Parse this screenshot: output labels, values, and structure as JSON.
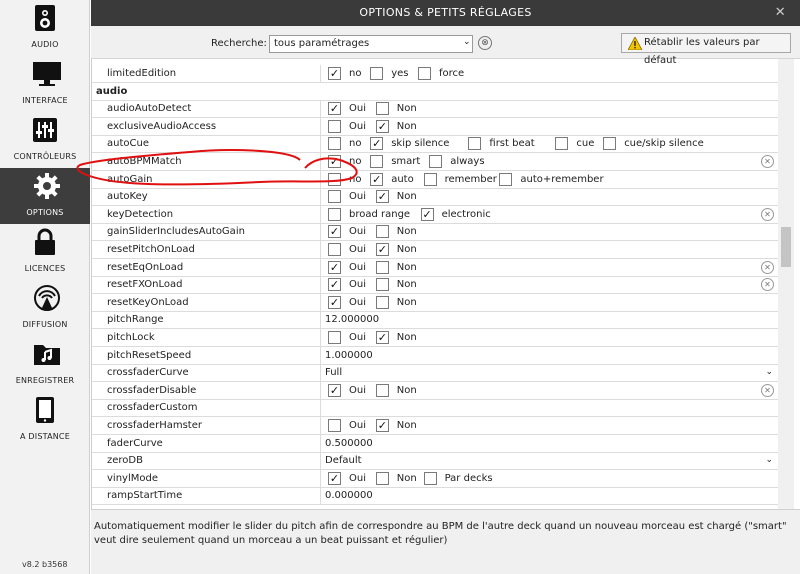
{
  "window": {
    "title": "OPTIONS & PETITS RÉGLAGES",
    "close": "✕"
  },
  "sidebar": {
    "items": [
      {
        "label": "AUDIO",
        "icon": "speaker-icon"
      },
      {
        "label": "INTERFACE",
        "icon": "monitor-icon"
      },
      {
        "label": "CONTRÔLEURS",
        "icon": "sliders-icon"
      },
      {
        "label": "OPTIONS",
        "icon": "gear-icon",
        "active": true
      },
      {
        "label": "LICENCES",
        "icon": "lock-icon"
      },
      {
        "label": "DIFFUSION",
        "icon": "broadcast-icon"
      },
      {
        "label": "ENREGISTRER",
        "icon": "music-folder-icon"
      },
      {
        "label": "A DISTANCE",
        "icon": "tablet-icon"
      }
    ],
    "version": "v8.2 b3568"
  },
  "search": {
    "label": "Recherche:",
    "value": "tous paramétrages",
    "caret": "⌄",
    "clear": "⊗",
    "reset_label": "Rétablir les valeurs par défaut"
  },
  "rows": [
    {
      "key": "limitedEdition",
      "options": [
        {
          "label": "no",
          "checked": true
        },
        {
          "label": "yes",
          "checked": false
        },
        {
          "label": "force",
          "checked": false
        }
      ]
    },
    {
      "key": "audio",
      "section": true
    },
    {
      "key": "audioAutoDetect",
      "options": [
        {
          "label": "Oui",
          "checked": true
        },
        {
          "label": "Non",
          "checked": false
        }
      ]
    },
    {
      "key": "exclusiveAudioAccess",
      "options": [
        {
          "label": "Oui",
          "checked": false
        },
        {
          "label": "Non",
          "checked": true
        }
      ]
    },
    {
      "key": "autoCue",
      "options": [
        {
          "label": "no",
          "checked": false
        },
        {
          "label": "skip silence",
          "checked": true
        },
        {
          "label": "first beat",
          "checked": false
        },
        {
          "label": "cue",
          "checked": false
        },
        {
          "label": "cue/skip silence",
          "checked": false
        }
      ]
    },
    {
      "key": "autoBPMMatch",
      "options": [
        {
          "label": "no",
          "checked": true
        },
        {
          "label": "smart",
          "checked": false
        },
        {
          "label": "always",
          "checked": false
        }
      ],
      "clear": true
    },
    {
      "key": "autoGain",
      "options": [
        {
          "label": "no",
          "checked": false
        },
        {
          "label": "auto",
          "checked": true
        },
        {
          "label": "remember",
          "checked": false
        },
        {
          "label": "auto+remember",
          "checked": false
        }
      ]
    },
    {
      "key": "autoKey",
      "options": [
        {
          "label": "Oui",
          "checked": false
        },
        {
          "label": "Non",
          "checked": true
        }
      ]
    },
    {
      "key": "keyDetection",
      "options": [
        {
          "label": "broad range",
          "checked": false
        },
        {
          "label": "electronic",
          "checked": true
        }
      ],
      "clear": true
    },
    {
      "key": "gainSliderIncludesAutoGain",
      "options": [
        {
          "label": "Oui",
          "checked": true
        },
        {
          "label": "Non",
          "checked": false
        }
      ]
    },
    {
      "key": "resetPitchOnLoad",
      "options": [
        {
          "label": "Oui",
          "checked": false
        },
        {
          "label": "Non",
          "checked": true
        }
      ]
    },
    {
      "key": "resetEqOnLoad",
      "options": [
        {
          "label": "Oui",
          "checked": true
        },
        {
          "label": "Non",
          "checked": false
        }
      ],
      "clear": true
    },
    {
      "key": "resetFXOnLoad",
      "options": [
        {
          "label": "Oui",
          "checked": true
        },
        {
          "label": "Non",
          "checked": false
        }
      ],
      "clear": true
    },
    {
      "key": "resetKeyOnLoad",
      "options": [
        {
          "label": "Oui",
          "checked": true
        },
        {
          "label": "Non",
          "checked": false
        }
      ]
    },
    {
      "key": "pitchRange",
      "text": "12.000000"
    },
    {
      "key": "pitchLock",
      "options": [
        {
          "label": "Oui",
          "checked": false
        },
        {
          "label": "Non",
          "checked": true
        }
      ]
    },
    {
      "key": "pitchResetSpeed",
      "text": "1.000000"
    },
    {
      "key": "crossfaderCurve",
      "text": "Full",
      "dropdown": true
    },
    {
      "key": "crossfaderDisable",
      "options": [
        {
          "label": "Oui",
          "checked": true
        },
        {
          "label": "Non",
          "checked": false
        }
      ],
      "clear": true
    },
    {
      "key": "crossfaderCustom",
      "text": ""
    },
    {
      "key": "crossfaderHamster",
      "options": [
        {
          "label": "Oui",
          "checked": false
        },
        {
          "label": "Non",
          "checked": true
        }
      ]
    },
    {
      "key": "faderCurve",
      "text": "0.500000"
    },
    {
      "key": "zeroDB",
      "text": "Default",
      "dropdown": true
    },
    {
      "key": "vinylMode",
      "options": [
        {
          "label": "Oui",
          "checked": true
        },
        {
          "label": "Non",
          "checked": false
        },
        {
          "label": "Par decks",
          "checked": false
        }
      ]
    },
    {
      "key": "rampStartTime",
      "text": "0.000000"
    }
  ],
  "description": "Automatiquement modifier le slider du pitch afin de correspondre au BPM de l'autre deck quand un nouveau morceau est chargé (\"smart\" veut dire seulement quand un morceau a un beat puissant et régulier)",
  "colors": {
    "sidebar_active": "#3d3d3d",
    "titlebar": "#3a3a3a",
    "annotation": "#e01010"
  }
}
